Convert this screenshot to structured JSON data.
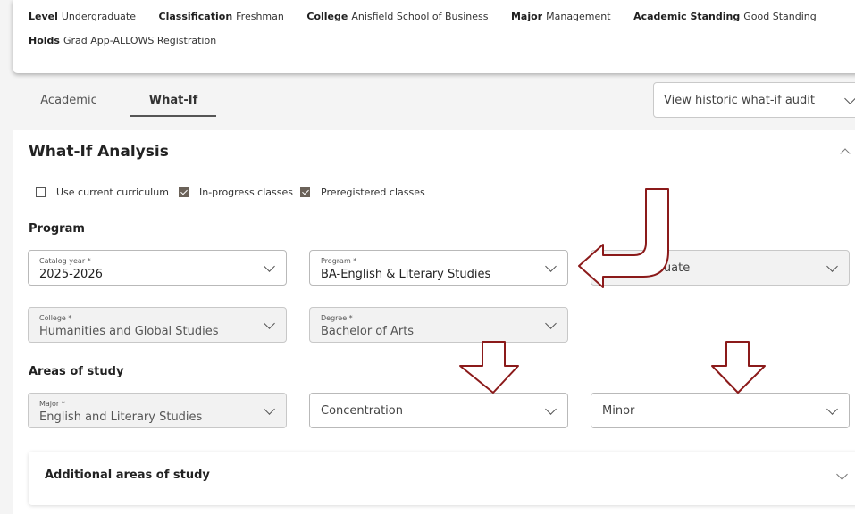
{
  "student": {
    "level_label": "Level",
    "level": "Undergraduate",
    "class_label": "Classification",
    "classification": "Freshman",
    "college_label": "College",
    "college": "Anisfield School of Business",
    "major_label": "Major",
    "major": "Management",
    "standing_label": "Academic Standing",
    "standing": "Good Standing",
    "holds_label": "Holds",
    "holds": "Grad App-ALLOWS Registration"
  },
  "tabs": {
    "academic": "Academic",
    "whatif": "What-If"
  },
  "historic": {
    "placeholder": "View historic what-if audit"
  },
  "whatif": {
    "title": "What-If Analysis",
    "checkboxes": [
      {
        "label": "Use current curriculum",
        "checked": false
      },
      {
        "label": "In-progress classes",
        "checked": true
      },
      {
        "label": "Preregistered classes",
        "checked": true
      }
    ],
    "program_section": "Program",
    "catalog_year": {
      "label": "Catalog year *",
      "value": "2025-2026"
    },
    "program": {
      "label": "Program *",
      "value": "BA-English & Literary Studies"
    },
    "level": {
      "value": "Undergraduate"
    },
    "college": {
      "label": "College *",
      "value": "Humanities and Global Studies"
    },
    "degree": {
      "label": "Degree *",
      "value": "Bachelor of Arts"
    },
    "areas_section": "Areas of study",
    "major": {
      "label": "Major *",
      "value": "English and Literary Studies"
    },
    "concentration": {
      "placeholder": "Concentration"
    },
    "minor": {
      "placeholder": "Minor"
    },
    "additional": "Additional areas of study"
  },
  "annotation_color": "#8b1a1a"
}
